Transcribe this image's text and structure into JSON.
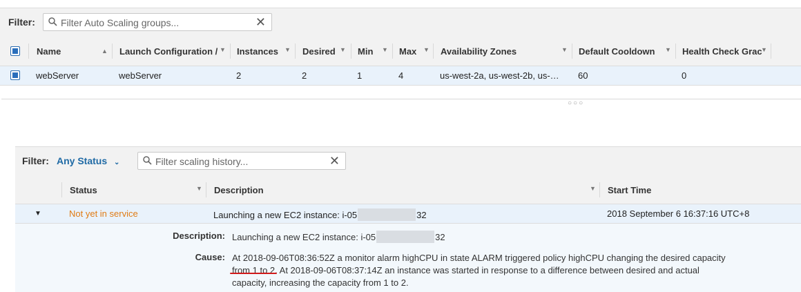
{
  "groups_filter": {
    "label": "Filter:",
    "placeholder": "Filter Auto Scaling groups..."
  },
  "groups_table": {
    "columns": [
      "Name",
      "Launch Configuration / ",
      "Instances",
      "Desired",
      "Min",
      "Max",
      "Availability Zones",
      "Default Cooldown",
      "Health Check Grac"
    ],
    "row": {
      "name": "webServer",
      "launch_configuration": "webServer",
      "instances": "2",
      "desired": "2",
      "min": "1",
      "max": "4",
      "availability_zones": "us-west-2a, us-west-2b, us-…",
      "default_cooldown": "60",
      "health_check_grace": "0"
    }
  },
  "resize_handle": "○○○",
  "history_filter": {
    "label": "Filter:",
    "status_value": "Any Status",
    "placeholder": "Filter scaling history..."
  },
  "history_table": {
    "columns": [
      "Status",
      "Description",
      "Start Time"
    ],
    "row": {
      "status": "Not yet in service",
      "description_prefix": "Launching a new EC2 instance: i-05",
      "description_suffix": "32",
      "start_time": "2018 September 6 16:37:16 UTC+8"
    },
    "detail": {
      "description_label": "Description:",
      "description_prefix": "Launching a new EC2 instance: i-05",
      "description_suffix": "32",
      "cause_label": "Cause:",
      "cause_line1": "At 2018-09-06T08:36:52Z a monitor alarm highCPU in state ALARM triggered policy highCPU changing the desired capacity",
      "cause_line2_highlight": "from 1 to 2",
      "cause_line2_rest": ". At 2018-09-06T08:37:14Z an instance was started in response to a difference between desired and actual",
      "cause_line3": "capacity, increasing the capacity from 1 to 2."
    }
  },
  "colors": {
    "status_pending": "#e07b14",
    "link_blue": "#1f6aa5",
    "annotation_red": "#d11a1a"
  }
}
